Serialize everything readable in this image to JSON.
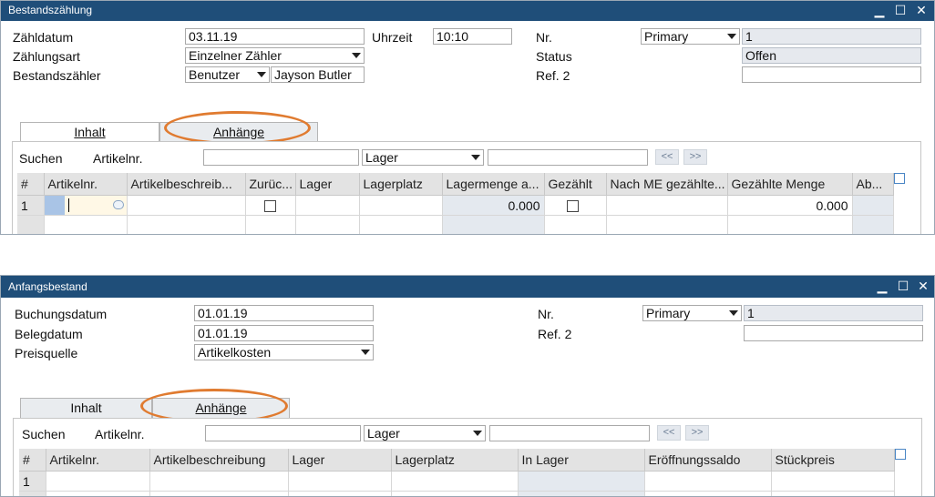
{
  "window1": {
    "title": "Bestandszählung",
    "controls": {
      "minimize": "▁",
      "maximize": "☐",
      "close": "✕"
    },
    "fields": {
      "zaehldatum_label": "Zähldatum",
      "zaehldatum_value": "03.11.19",
      "uhrzeit_label": "Uhrzeit",
      "uhrzeit_value": "10:10",
      "nr_label": "Nr.",
      "nr_series": "Primary",
      "nr_value": "1",
      "zaehlungsart_label": "Zählungsart",
      "zaehlungsart_value": "Einzelner Zähler",
      "status_label": "Status",
      "status_value": "Offen",
      "bestandszaehler_label": "Bestandszähler",
      "bestandszaehler_type": "Benutzer",
      "bestandszaehler_value": "Jayson Butler",
      "ref2_label": "Ref. 2",
      "ref2_value": ""
    },
    "tabs": {
      "inhalt": "Inhalt",
      "anhaenge": "Anhänge"
    },
    "search": {
      "label": "Suchen",
      "field_label": "Artikelnr.",
      "field_value": "",
      "lager": "Lager",
      "lager_value": "",
      "prev": "<<",
      "next": ">>"
    },
    "grid": {
      "headers": [
        "#",
        "Artikelnr.",
        "Artikelbeschreib...",
        "Zurüc...",
        "Lager",
        "Lagerplatz",
        "Lagermenge a...",
        "Gezählt",
        "Nach ME gezählte...",
        "Gezählte Menge",
        "Ab..."
      ],
      "row1": {
        "num": "1",
        "lagermenge": "0.000",
        "gezaehlte_menge": "0.000"
      }
    }
  },
  "window2": {
    "title": "Anfangsbestand",
    "controls": {
      "minimize": "▁",
      "maximize": "☐",
      "close": "✕"
    },
    "fields": {
      "buchungsdatum_label": "Buchungsdatum",
      "buchungsdatum_value": "01.01.19",
      "nr_label": "Nr.",
      "nr_series": "Primary",
      "nr_value": "1",
      "belegdatum_label": "Belegdatum",
      "belegdatum_value": "01.01.19",
      "ref2_label": "Ref. 2",
      "ref2_value": "",
      "preisquelle_label": "Preisquelle",
      "preisquelle_value": "Artikelkosten"
    },
    "tabs": {
      "inhalt": "Inhalt",
      "anhaenge": "Anhänge"
    },
    "search": {
      "label": "Suchen",
      "field_label": "Artikelnr.",
      "field_value": "",
      "lager": "Lager",
      "lager_value": "",
      "prev": "<<",
      "next": ">>"
    },
    "grid": {
      "headers": [
        "#",
        "Artikelnr.",
        "Artikelbeschreibung",
        "Lager",
        "Lagerplatz",
        "In Lager",
        "Eröffnungssaldo",
        "Stückpreis"
      ],
      "row1": {
        "num": "1"
      }
    }
  },
  "colors": {
    "titlebar": "#1f4e79",
    "highlight_oval": "#e07b30",
    "readonly_field": "#e6e9ee"
  }
}
